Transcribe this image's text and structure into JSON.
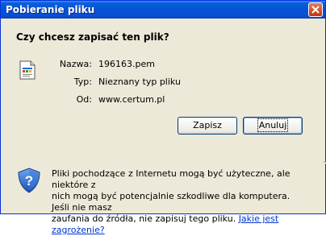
{
  "window": {
    "title": "Pobieranie pliku"
  },
  "dialog": {
    "question": "Czy chcesz zapisać ten plik?",
    "fields": [
      {
        "label": "Nazwa:",
        "value": "196163.pem"
      },
      {
        "label": "Typ:",
        "value": "Nieznany typ pliku"
      },
      {
        "label": "Od:",
        "value": "www.certum.pl"
      }
    ],
    "buttons": {
      "save": "Zapisz",
      "cancel": "Anuluj"
    }
  },
  "warning": {
    "line1": "Pliki pochodzące z Internetu mogą być użyteczne, ale niektóre z",
    "line2": "nich mogą być potencjalnie szkodliwe dla komputera. Jeśli nie masz",
    "line3": "zaufania do źródła, nie zapisuj tego pliku.",
    "link": "Jakie jest zagrożenie?"
  },
  "icons": {
    "file": "file-icon",
    "shield": "shield-icon",
    "close": "close-icon"
  },
  "colors": {
    "titlebar": "#0553d6",
    "dialog_bg": "#ece9d8",
    "link": "#0033cc"
  }
}
